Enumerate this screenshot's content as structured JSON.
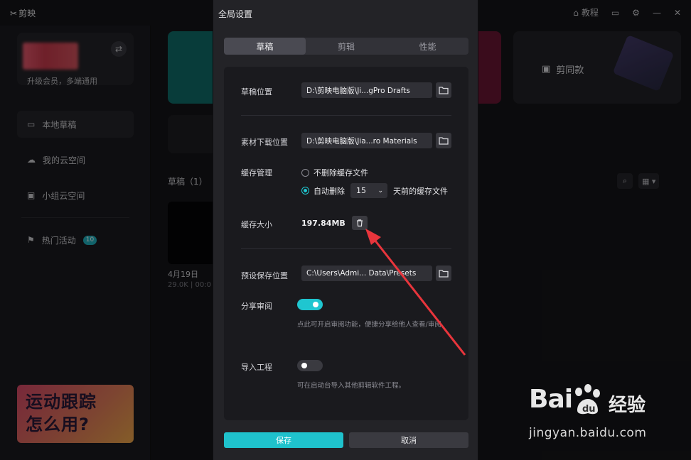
{
  "app": {
    "logo_text": "剪映",
    "tutorial_label": "教程"
  },
  "sidebar": {
    "profile_subtitle": "升级会员，多端通用",
    "items": [
      {
        "label": "本地草稿"
      },
      {
        "label": "我的云空间"
      },
      {
        "label": "小组云空间"
      },
      {
        "label": "热门活动",
        "badge": "10"
      }
    ],
    "promo_line1": "运动跟踪",
    "promo_line2": "怎么用?"
  },
  "main": {
    "card_label": "剪同款",
    "drafts_title": "草稿（1）",
    "draft_date": "4月19日",
    "draft_meta": "29.0K | 00:0"
  },
  "modal": {
    "title": "全局设置",
    "tabs": [
      {
        "label": "草稿",
        "active": true
      },
      {
        "label": "剪辑",
        "active": false
      },
      {
        "label": "性能",
        "active": false
      }
    ],
    "draft_location": {
      "label": "草稿位置",
      "value": "D:\\剪映电脑版\\Ji...gPro Drafts"
    },
    "material_location": {
      "label": "素材下载位置",
      "value": "D:\\剪映电脑版\\Jia...ro Materials"
    },
    "cache": {
      "label": "缓存管理",
      "option_keep": "不删除缓存文件",
      "option_auto": "自动删除",
      "days": "15",
      "days_suffix": "天前的缓存文件",
      "selected": "auto"
    },
    "cache_size": {
      "label": "缓存大小",
      "value": "197.84MB"
    },
    "preset_location": {
      "label": "预设保存位置",
      "value": "C:\\Users\\Admi... Data\\Presets"
    },
    "share_review": {
      "label": "分享审阅",
      "enabled": true,
      "hint": "点此可开启审阅功能，便捷分享给他人查看/审阅"
    },
    "import_project": {
      "label": "导入工程",
      "enabled": false,
      "hint": "可在启动台导入其他剪辑软件工程。"
    },
    "save_label": "保存",
    "cancel_label": "取消"
  },
  "watermark": {
    "brand": "Bai",
    "brand_suffix": "du",
    "cn_text": "经验",
    "url": "jingyan.baidu.com"
  },
  "colors": {
    "accent": "#1fc6d0",
    "annotation_arrow": "#e8353c"
  }
}
